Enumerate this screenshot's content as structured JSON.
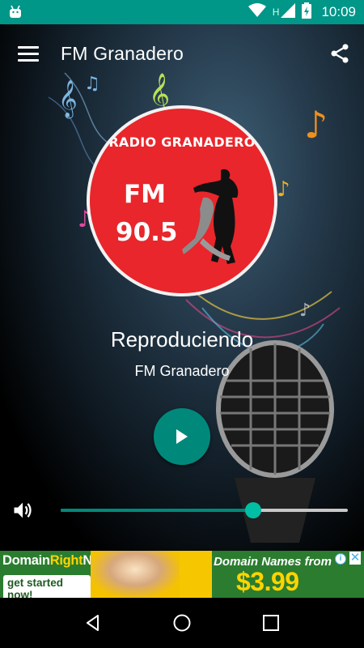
{
  "status_bar": {
    "time": "10:09",
    "network_letter": "H",
    "icons": [
      "android-debug-icon",
      "wifi-icon",
      "signal-icon",
      "battery-charging-icon"
    ]
  },
  "toolbar": {
    "title": "FM Granadero",
    "menu_icon": "hamburger-menu-icon",
    "share_icon": "share-icon"
  },
  "logo": {
    "radio_name": "RADIO GRANADERO",
    "band": "FM",
    "frequency": "90.5"
  },
  "player": {
    "status": "Reproduciendo",
    "station": "FM Granadero",
    "play_icon": "play-icon",
    "volume_icon": "volume-icon",
    "volume_level": 0.67
  },
  "ad": {
    "brand_part1": "Domain",
    "brand_part2": "Right",
    "brand_part3": "Now",
    "cta": "get started now!",
    "headline": "Domain Names from",
    "price": "$3.99"
  },
  "nav_bar": {
    "icons": [
      "back-icon",
      "home-icon",
      "recents-icon"
    ]
  },
  "colors": {
    "accent": "#009688",
    "play_button": "#00897b",
    "logo_red": "#e8262b",
    "slider_thumb": "#00bfa5"
  }
}
